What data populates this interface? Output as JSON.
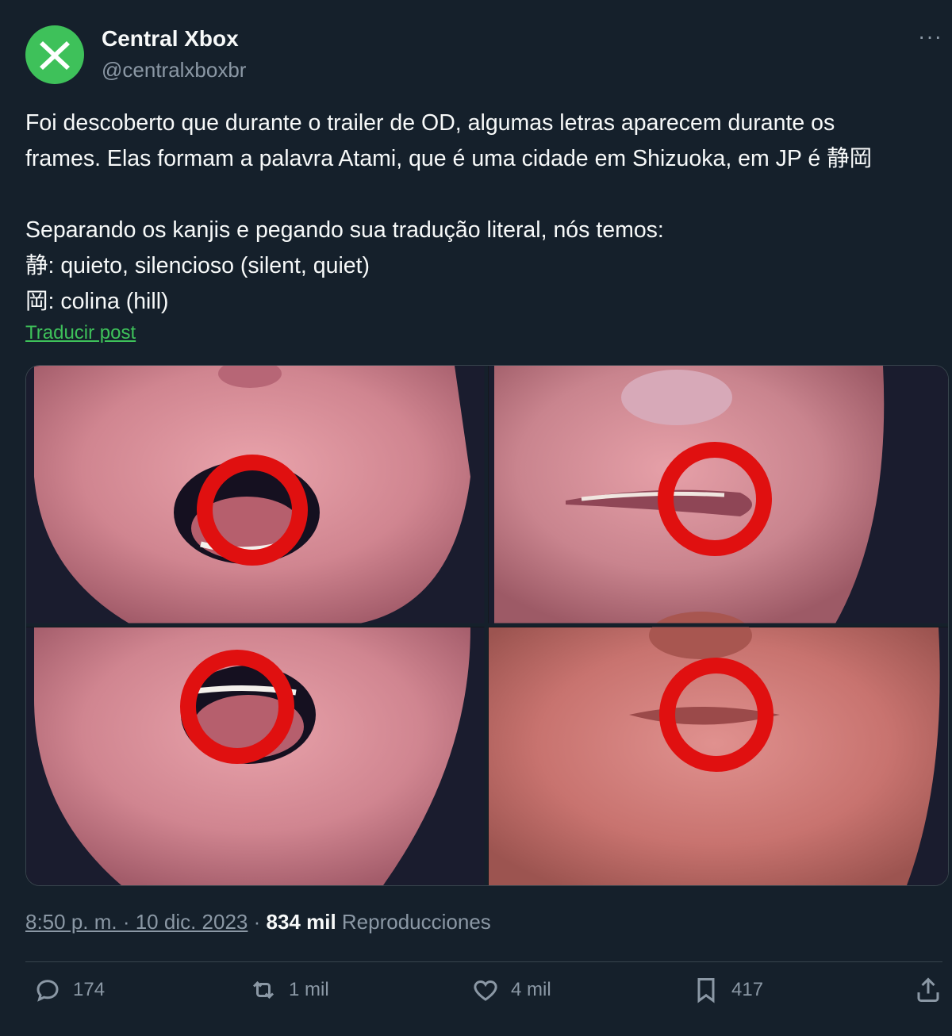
{
  "author": {
    "name": "Central Xbox",
    "handle": "@centralxboxbr",
    "avatar_color": "#3ec15a"
  },
  "tweet": {
    "lines": [
      "Foi descoberto que durante o trailer de OD, algumas letras aparecem durante os",
      "frames. Elas formam a palavra Atami, que é uma cidade em Shizuoka, em JP é 静岡",
      "",
      "Separando os kanjis e pegando sua tradução literal, nós temos:",
      "静: quieto, silencioso (silent, quiet)",
      "岡: colina (hill)"
    ],
    "translate_link": "Traducir post"
  },
  "media": {
    "count": 4,
    "description_icon": "face-closeup-images",
    "highlight_color": "#e01010"
  },
  "meta": {
    "timestamp": "8:50 p. m. · 10 dic. 2023",
    "separator": " · ",
    "views_count": "834 mil",
    "views_label": "Reproducciones"
  },
  "actions": {
    "reply": "174",
    "retweet": "1 mil",
    "like": "4 mil",
    "bookmark": "417"
  },
  "colors": {
    "background": "#15202b",
    "text": "#f7f9f9",
    "muted": "#8b98a5",
    "accent": "#3ec15a"
  }
}
